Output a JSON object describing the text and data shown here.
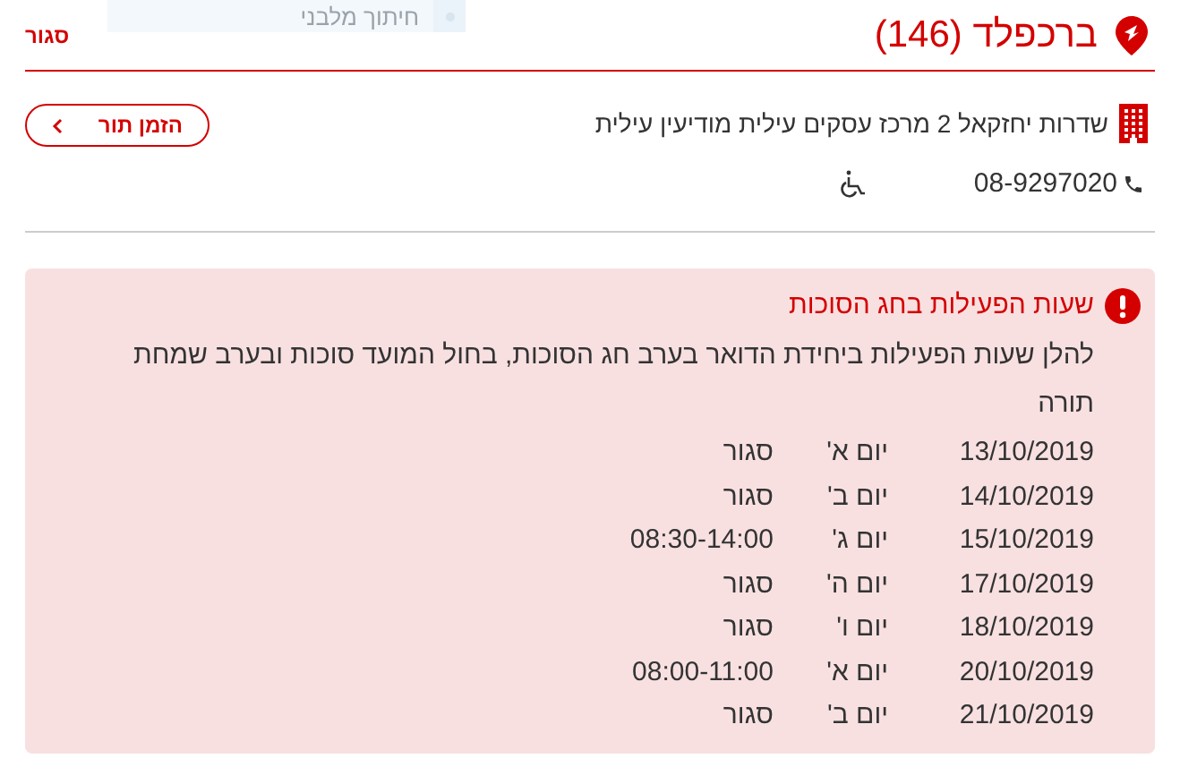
{
  "overlay_menu": {
    "label": "חיתוך מלבני"
  },
  "header": {
    "title": "ברכפלד (146)",
    "close": "סגור"
  },
  "branch": {
    "address": "שדרות יחזקאל 2 מרכז עסקים עילית מודיעין עילית",
    "phone": "08-9297020",
    "accessible": true,
    "book_button": "הזמן תור"
  },
  "notice": {
    "title": "שעות הפעילות בחג הסוכות",
    "text": "להלן שעות הפעילות ביחידת הדואר בערב חג הסוכות, בחול המועד סוכות ובערב שמחת תורה",
    "rows": [
      {
        "date": "13/10/2019",
        "day": "יום א'",
        "hours": "סגור"
      },
      {
        "date": "14/10/2019",
        "day": "יום ב'",
        "hours": "סגור"
      },
      {
        "date": "15/10/2019",
        "day": "יום ג'",
        "hours": "08:30-14:00"
      },
      {
        "date": "17/10/2019",
        "day": "יום ה'",
        "hours": "סגור"
      },
      {
        "date": "18/10/2019",
        "day": "יום ו'",
        "hours": "סגור"
      },
      {
        "date": "20/10/2019",
        "day": "יום א'",
        "hours": "08:00-11:00"
      },
      {
        "date": "21/10/2019",
        "day": "יום ב'",
        "hours": "סגור"
      }
    ]
  }
}
